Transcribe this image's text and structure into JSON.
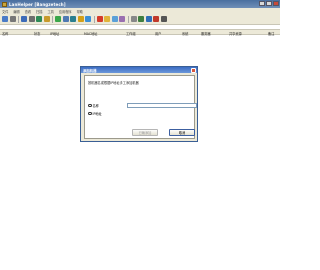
{
  "window": {
    "title": "LanHelper [Bangzetech]"
  },
  "menu": [
    "文件",
    "编辑",
    "查看",
    "扫描",
    "工具",
    "应用程序",
    "帮助"
  ],
  "toolbar": {
    "icons": [
      {
        "name": "new-icon",
        "color": "#4a7bc7"
      },
      {
        "name": "dropdown-icon",
        "color": "#777777"
      },
      {
        "name": "save-icon",
        "color": "#3d6bb8"
      },
      {
        "name": "print-icon",
        "color": "#6d6d6d"
      },
      {
        "name": "refresh-icon",
        "color": "#2e8b57"
      },
      {
        "name": "edit-icon",
        "color": "#c89a2a"
      },
      {
        "name": "add-icon",
        "color": "#3aa64a"
      },
      {
        "name": "computer-icon",
        "color": "#4f79b3"
      },
      {
        "name": "network-icon",
        "color": "#2a7f8f"
      },
      {
        "name": "send-icon",
        "color": "#d4a017"
      },
      {
        "name": "scan-icon",
        "color": "#3b8fd6"
      },
      {
        "name": "stop-icon",
        "color": "#d43a2a"
      },
      {
        "name": "folder-icon",
        "color": "#e0b43a"
      },
      {
        "name": "message-icon",
        "color": "#5aa0d8"
      },
      {
        "name": "user-icon",
        "color": "#9a6fb0"
      },
      {
        "name": "settings-icon",
        "color": "#888888"
      },
      {
        "name": "link-icon",
        "color": "#3f7f3f"
      },
      {
        "name": "help-icon",
        "color": "#2f6fb8"
      },
      {
        "name": "info-icon",
        "color": "#c0392b"
      },
      {
        "name": "exit-icon",
        "color": "#555555"
      }
    ]
  },
  "table": {
    "headers": [
      "名称",
      "状态",
      "IP地址",
      "MAC地址",
      "工作组",
      "用户",
      "系统",
      "服务器",
      "共享资源",
      "备注"
    ]
  },
  "dialog": {
    "title": "添加机器",
    "instruction": "按机器名或根据IP地址手工添加机器",
    "radio_name": "名称",
    "radio_ip": "IP地址",
    "ok_label": "已确添加",
    "cancel_label": "取消"
  }
}
